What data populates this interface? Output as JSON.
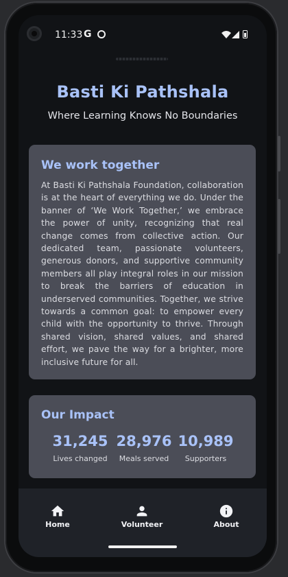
{
  "status_bar": {
    "time": "11:33",
    "google_glyph": "G"
  },
  "header": {
    "title": "Basti Ki Pathshala",
    "subtitle": "Where Learning Knows No Boundaries"
  },
  "about": {
    "heading": "We work together",
    "body": "At Basti Ki Pathshala Foundation, collaboration is at the heart of everything we do. Under the banner of ‘We Work Together,’ we embrace the power of unity, recognizing that real change comes from collective action. Our dedicated team, passionate volunteers, generous donors, and supportive community members all play integral roles in our mission to break the barriers of education in underserved communities. Together, we strive towards a common goal: to empower every child with the opportunity to thrive. Through shared vision, shared values, and shared effort, we pave the way for a brighter, more inclusive future for all."
  },
  "impact": {
    "heading": "Our Impact",
    "stats": [
      {
        "value": "31,245",
        "label": "Lives changed"
      },
      {
        "value": "28,976",
        "label": "Meals served"
      },
      {
        "value": "10,989",
        "label": "Supporters"
      }
    ]
  },
  "nav": {
    "items": [
      {
        "label": "Home",
        "icon": "home-icon"
      },
      {
        "label": "Volunteer",
        "icon": "person-icon"
      },
      {
        "label": "About",
        "icon": "info-icon"
      }
    ]
  },
  "colors": {
    "accent": "#a9c2f8",
    "card": "#4b4d57",
    "background": "#111316",
    "nav_background": "#1f2228"
  }
}
